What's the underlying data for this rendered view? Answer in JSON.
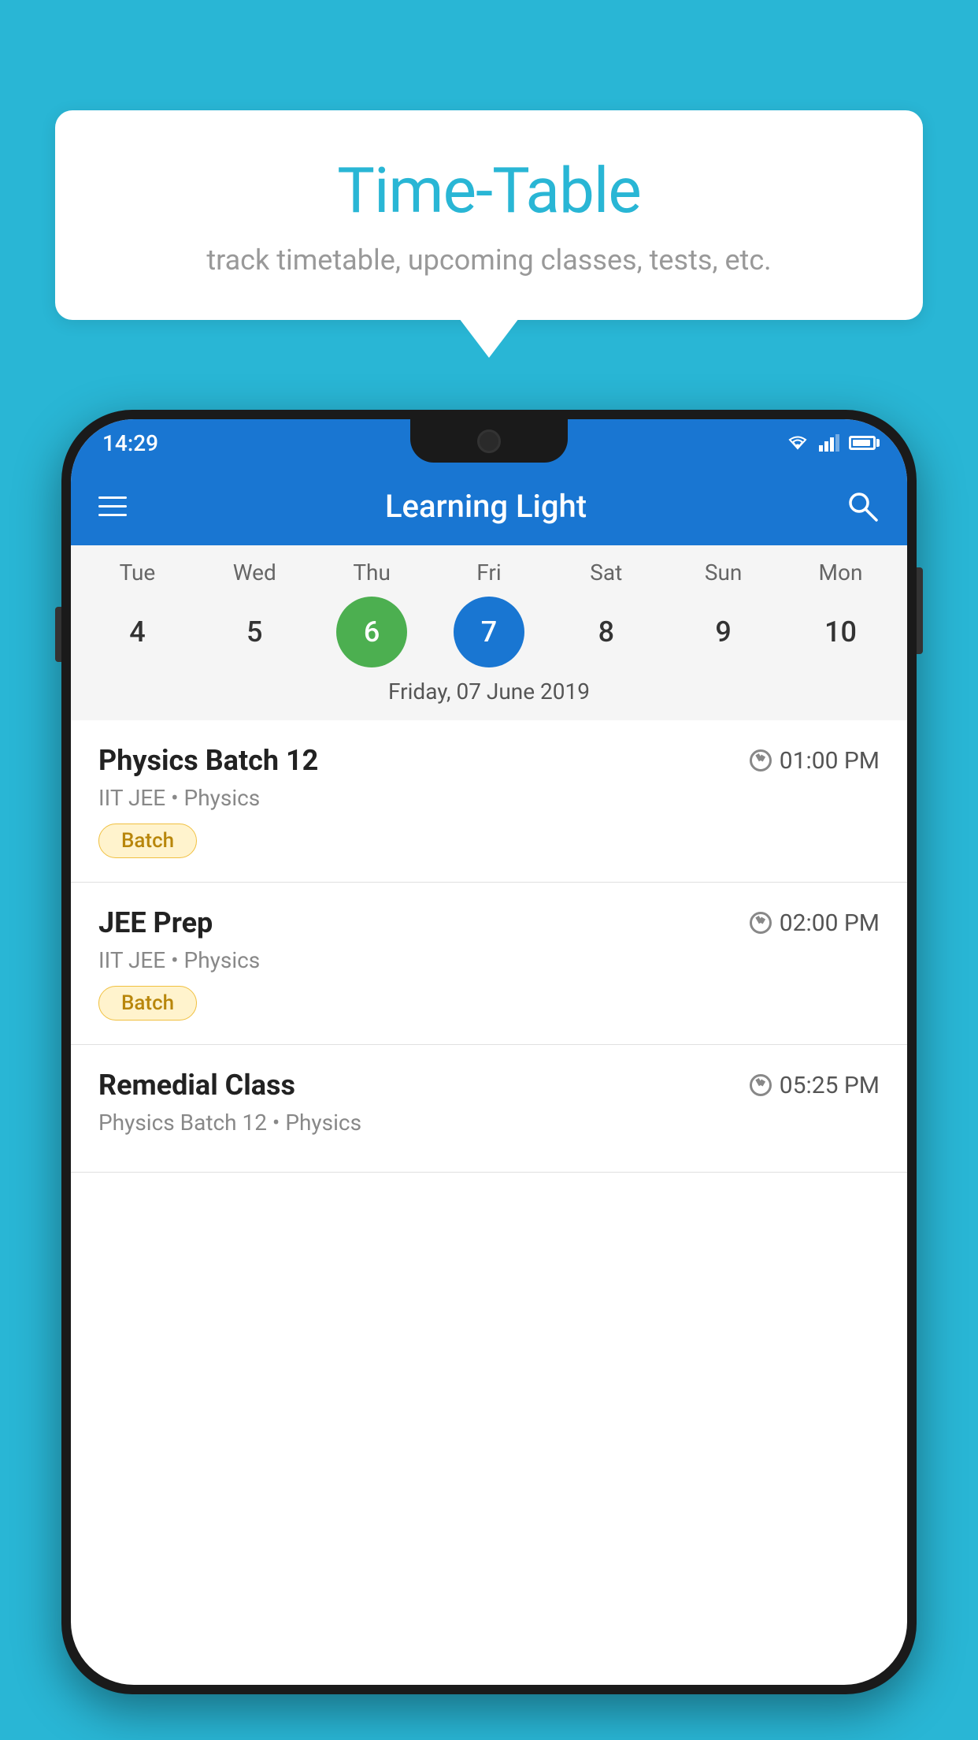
{
  "background_color": "#29B6D5",
  "speech_bubble": {
    "title": "Time-Table",
    "subtitle": "track timetable, upcoming classes, tests, etc."
  },
  "status_bar": {
    "time": "14:29"
  },
  "app_bar": {
    "title": "Learning Light"
  },
  "calendar": {
    "days": [
      {
        "label": "Tue",
        "number": "4"
      },
      {
        "label": "Wed",
        "number": "5"
      },
      {
        "label": "Thu",
        "number": "6",
        "state": "today"
      },
      {
        "label": "Fri",
        "number": "7",
        "state": "selected"
      },
      {
        "label": "Sat",
        "number": "8"
      },
      {
        "label": "Sun",
        "number": "9"
      },
      {
        "label": "Mon",
        "number": "10"
      }
    ],
    "selected_date_label": "Friday, 07 June 2019"
  },
  "schedule_items": [
    {
      "title": "Physics Batch 12",
      "time": "01:00 PM",
      "subtitle": "IIT JEE • Physics",
      "badge": "Batch"
    },
    {
      "title": "JEE Prep",
      "time": "02:00 PM",
      "subtitle": "IIT JEE • Physics",
      "badge": "Batch"
    },
    {
      "title": "Remedial Class",
      "time": "05:25 PM",
      "subtitle": "Physics Batch 12 • Physics",
      "badge": null
    }
  ],
  "icons": {
    "hamburger": "☰",
    "search": "🔍"
  }
}
